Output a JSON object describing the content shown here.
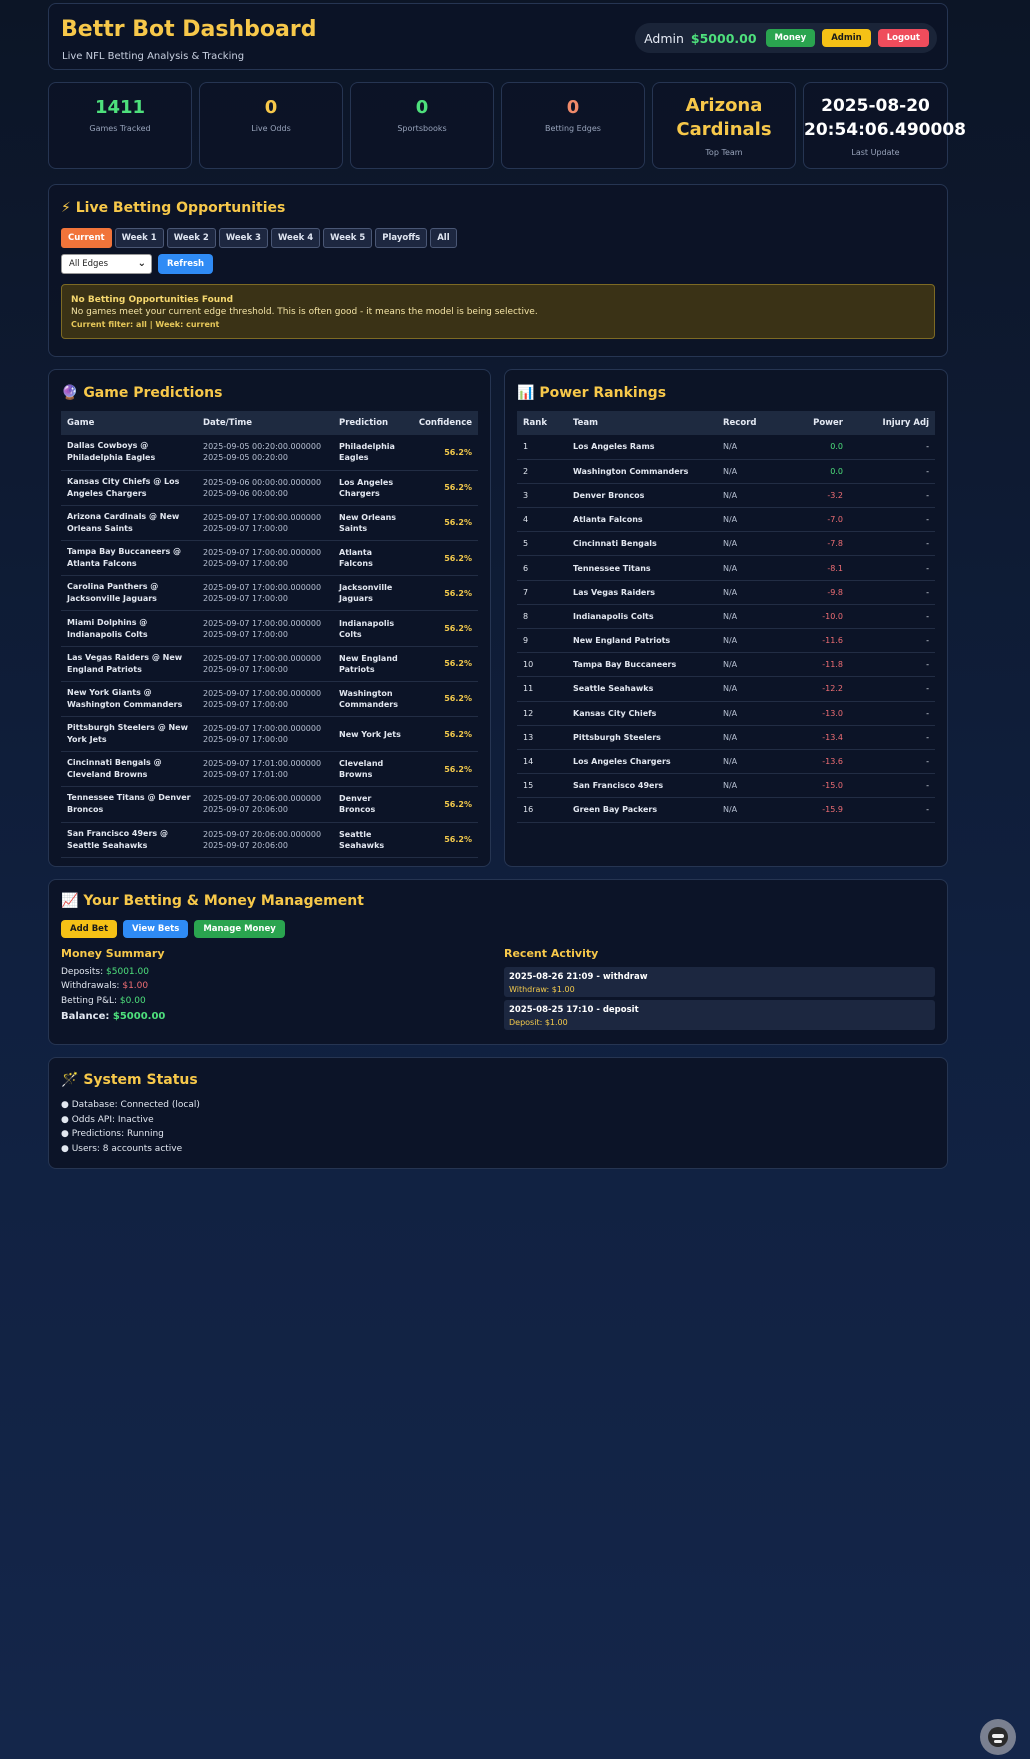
{
  "header": {
    "title": "Bettr Bot Dashboard",
    "subtitle": "Live NFL Betting Analysis & Tracking",
    "user": "Admin",
    "balance": "$5000.00",
    "money_btn": "Money",
    "admin_btn": "Admin",
    "logout_btn": "Logout"
  },
  "stats": [
    {
      "value": "1411",
      "label": "Games Tracked",
      "color": "#4ee07c"
    },
    {
      "value": "0",
      "label": "Live Odds",
      "color": "#f7c84a"
    },
    {
      "value": "0",
      "label": "Sportsbooks",
      "color": "#4ee07c"
    },
    {
      "value": "0",
      "label": "Betting Edges",
      "color": "#f08a6a"
    },
    {
      "value_line1": "Arizona",
      "value_line2": "Cardinals",
      "label": "Top Team",
      "color": "#f7c84a"
    },
    {
      "value_line1": "2025-08-20",
      "value_line2": "20:54:06.490008",
      "label": "Last Update",
      "color": "#ffffff"
    }
  ],
  "live": {
    "title": "Live Betting Opportunities",
    "tabs": [
      "Current",
      "Week 1",
      "Week 2",
      "Week 3",
      "Week 4",
      "Week 5",
      "Playoffs",
      "All"
    ],
    "select_value": "All Edges",
    "refresh": "Refresh",
    "alert_title": "No Betting Opportunities Found",
    "alert_text": "No games meet your current edge threshold. This is often good - it means the model is being selective.",
    "alert_filter": "Current filter: all | Week: current"
  },
  "predictions": {
    "title": "Game Predictions",
    "headers": [
      "Game",
      "Date/Time",
      "Prediction",
      "Confidence"
    ],
    "rows": [
      {
        "game": "Dallas Cowboys @ Philadelphia Eagles",
        "dt": "2025-09-05 00:20:00.000000 2025-09-05 00:20:00",
        "pred": "Philadelphia Eagles",
        "conf": "56.2%"
      },
      {
        "game": "Kansas City Chiefs @ Los Angeles Chargers",
        "dt": "2025-09-06 00:00:00.000000 2025-09-06 00:00:00",
        "pred": "Los Angeles Chargers",
        "conf": "56.2%"
      },
      {
        "game": "Arizona Cardinals @ New Orleans Saints",
        "dt": "2025-09-07 17:00:00.000000 2025-09-07 17:00:00",
        "pred": "New Orleans Saints",
        "conf": "56.2%"
      },
      {
        "game": "Tampa Bay Buccaneers @ Atlanta Falcons",
        "dt": "2025-09-07 17:00:00.000000 2025-09-07 17:00:00",
        "pred": "Atlanta Falcons",
        "conf": "56.2%"
      },
      {
        "game": "Carolina Panthers @ Jacksonville Jaguars",
        "dt": "2025-09-07 17:00:00.000000 2025-09-07 17:00:00",
        "pred": "Jacksonville Jaguars",
        "conf": "56.2%"
      },
      {
        "game": "Miami Dolphins @ Indianapolis Colts",
        "dt": "2025-09-07 17:00:00.000000 2025-09-07 17:00:00",
        "pred": "Indianapolis Colts",
        "conf": "56.2%"
      },
      {
        "game": "Las Vegas Raiders @ New England Patriots",
        "dt": "2025-09-07 17:00:00.000000 2025-09-07 17:00:00",
        "pred": "New England Patriots",
        "conf": "56.2%"
      },
      {
        "game": "New York Giants @ Washington Commanders",
        "dt": "2025-09-07 17:00:00.000000 2025-09-07 17:00:00",
        "pred": "Washington Commanders",
        "conf": "56.2%"
      },
      {
        "game": "Pittsburgh Steelers @ New York Jets",
        "dt": "2025-09-07 17:00:00.000000 2025-09-07 17:00:00",
        "pred": "New York Jets",
        "conf": "56.2%"
      },
      {
        "game": "Cincinnati Bengals @ Cleveland Browns",
        "dt": "2025-09-07 17:01:00.000000 2025-09-07 17:01:00",
        "pred": "Cleveland Browns",
        "conf": "56.2%"
      },
      {
        "game": "Tennessee Titans @ Denver Broncos",
        "dt": "2025-09-07 20:06:00.000000 2025-09-07 20:06:00",
        "pred": "Denver Broncos",
        "conf": "56.2%"
      },
      {
        "game": "San Francisco 49ers @ Seattle Seahawks",
        "dt": "2025-09-07 20:06:00.000000 2025-09-07 20:06:00",
        "pred": "Seattle Seahawks",
        "conf": "56.2%"
      }
    ]
  },
  "rankings": {
    "title": "Power Rankings",
    "headers": [
      "Rank",
      "Team",
      "Record",
      "Power",
      "Injury Adj"
    ],
    "rows": [
      {
        "rank": "1",
        "team": "Los Angeles Rams",
        "record": "N/A",
        "power": "0.0",
        "inj": "-"
      },
      {
        "rank": "2",
        "team": "Washington Commanders",
        "record": "N/A",
        "power": "0.0",
        "inj": "-"
      },
      {
        "rank": "3",
        "team": "Denver Broncos",
        "record": "N/A",
        "power": "-3.2",
        "inj": "-"
      },
      {
        "rank": "4",
        "team": "Atlanta Falcons",
        "record": "N/A",
        "power": "-7.0",
        "inj": "-"
      },
      {
        "rank": "5",
        "team": "Cincinnati Bengals",
        "record": "N/A",
        "power": "-7.8",
        "inj": "-"
      },
      {
        "rank": "6",
        "team": "Tennessee Titans",
        "record": "N/A",
        "power": "-8.1",
        "inj": "-"
      },
      {
        "rank": "7",
        "team": "Las Vegas Raiders",
        "record": "N/A",
        "power": "-9.8",
        "inj": "-"
      },
      {
        "rank": "8",
        "team": "Indianapolis Colts",
        "record": "N/A",
        "power": "-10.0",
        "inj": "-"
      },
      {
        "rank": "9",
        "team": "New England Patriots",
        "record": "N/A",
        "power": "-11.6",
        "inj": "-"
      },
      {
        "rank": "10",
        "team": "Tampa Bay Buccaneers",
        "record": "N/A",
        "power": "-11.8",
        "inj": "-"
      },
      {
        "rank": "11",
        "team": "Seattle Seahawks",
        "record": "N/A",
        "power": "-12.2",
        "inj": "-"
      },
      {
        "rank": "12",
        "team": "Kansas City Chiefs",
        "record": "N/A",
        "power": "-13.0",
        "inj": "-"
      },
      {
        "rank": "13",
        "team": "Pittsburgh Steelers",
        "record": "N/A",
        "power": "-13.4",
        "inj": "-"
      },
      {
        "rank": "14",
        "team": "Los Angeles Chargers",
        "record": "N/A",
        "power": "-13.6",
        "inj": "-"
      },
      {
        "rank": "15",
        "team": "San Francisco 49ers",
        "record": "N/A",
        "power": "-15.0",
        "inj": "-"
      },
      {
        "rank": "16",
        "team": "Green Bay Packers",
        "record": "N/A",
        "power": "-15.9",
        "inj": "-"
      }
    ]
  },
  "money": {
    "title": "Your Betting & Money Management",
    "add_bet": "Add Bet",
    "view_bets": "View Bets",
    "manage_money": "Manage Money",
    "summary_title": "Money Summary",
    "deposits_label": "Deposits:",
    "deposits_value": "$5001.00",
    "withdrawals_label": "Withdrawals:",
    "withdrawals_value": "$1.00",
    "pnl_label": "Betting P&L:",
    "pnl_value": "$0.00",
    "balance_label": "Balance:",
    "balance_value": "$5000.00",
    "activity_title": "Recent Activity",
    "activity": [
      {
        "title": "2025-08-26 21:09 - withdraw",
        "detail": "Withdraw: $1.00"
      },
      {
        "title": "2025-08-25 17:10 - deposit",
        "detail": "Deposit: $1.00"
      }
    ]
  },
  "system": {
    "title": "System Status",
    "items": [
      "● Database: Connected (local)",
      "● Odds API: Inactive",
      "● Predictions: Running",
      "● Users: 8 accounts active"
    ]
  },
  "icons": {
    "live": "lightning-icon",
    "predictions": "crystal-ball-icon",
    "rankings": "bar-chart-icon",
    "money": "trend-chart-icon",
    "system": "wand-icon",
    "assistant": "bot-avatar-icon"
  }
}
